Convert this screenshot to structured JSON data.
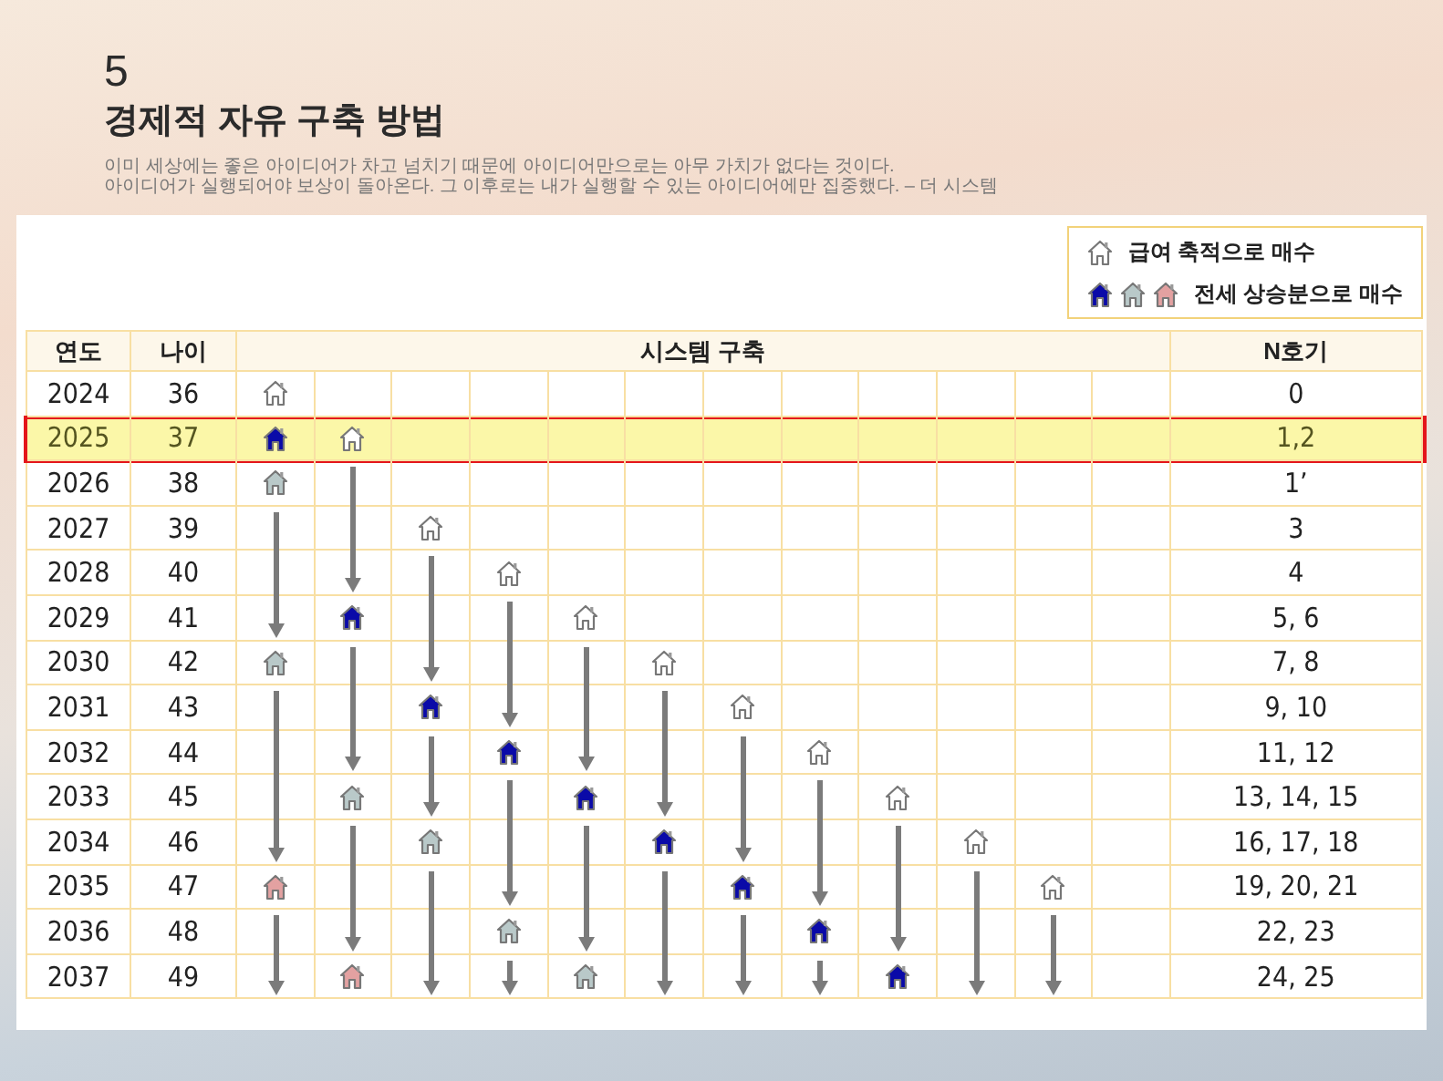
{
  "section_number": "5",
  "title": "경제적 자유 구축 방법",
  "quote_lines": [
    "이미 세상에는 좋은 아이디어가 차고 넘치기 때문에 아이디어만으로는 아무 가치가 없다는 것이다.",
    "아이디어가 실행되어야 보상이 돌아온다. 그 이후로는 내가 실행할 수 있는 아이디어에만 집중했다. – 더 시스템"
  ],
  "legend": [
    {
      "icons": [
        {
          "kind": "outline"
        }
      ],
      "label": "급여 축적으로 매수"
    },
    {
      "icons": [
        {
          "kind": "blue"
        },
        {
          "kind": "grey"
        },
        {
          "kind": "pink"
        }
      ],
      "label": "전세 상승분으로 매수"
    }
  ],
  "table": {
    "columns": [
      "연도",
      "나이",
      "시스템 구축",
      "N호기"
    ],
    "rows": [
      {
        "year": "2024",
        "age": "36",
        "units": "0",
        "selected": false,
        "cells": [
          {
            "kind": "outline"
          },
          {
            "kind": "empty"
          },
          {
            "kind": "empty"
          },
          {
            "kind": "empty"
          },
          {
            "kind": "empty"
          },
          {
            "kind": "empty"
          },
          {
            "kind": "empty"
          },
          {
            "kind": "empty"
          },
          {
            "kind": "empty"
          },
          {
            "kind": "empty"
          },
          {
            "kind": "empty"
          },
          {
            "kind": "empty"
          }
        ]
      },
      {
        "year": "2025",
        "age": "37",
        "units": "1,2",
        "selected": true,
        "cells": [
          {
            "kind": "blue"
          },
          {
            "kind": "outline"
          },
          {
            "kind": "empty"
          },
          {
            "kind": "empty"
          },
          {
            "kind": "empty"
          },
          {
            "kind": "empty"
          },
          {
            "kind": "empty"
          },
          {
            "kind": "empty"
          },
          {
            "kind": "empty"
          },
          {
            "kind": "empty"
          },
          {
            "kind": "empty"
          },
          {
            "kind": "empty"
          }
        ]
      },
      {
        "year": "2026",
        "age": "38",
        "units": "1’",
        "selected": false,
        "cells": [
          {
            "kind": "grey"
          },
          {
            "kind": "empty"
          },
          {
            "kind": "empty"
          },
          {
            "kind": "empty"
          },
          {
            "kind": "empty"
          },
          {
            "kind": "empty"
          },
          {
            "kind": "empty"
          },
          {
            "kind": "empty"
          },
          {
            "kind": "empty"
          },
          {
            "kind": "empty"
          },
          {
            "kind": "empty"
          },
          {
            "kind": "empty"
          }
        ]
      },
      {
        "year": "2027",
        "age": "39",
        "units": "3",
        "selected": false,
        "cells": [
          {
            "kind": "empty"
          },
          {
            "kind": "empty"
          },
          {
            "kind": "outline"
          },
          {
            "kind": "empty"
          },
          {
            "kind": "empty"
          },
          {
            "kind": "empty"
          },
          {
            "kind": "empty"
          },
          {
            "kind": "empty"
          },
          {
            "kind": "empty"
          },
          {
            "kind": "empty"
          },
          {
            "kind": "empty"
          },
          {
            "kind": "empty"
          }
        ]
      },
      {
        "year": "2028",
        "age": "40",
        "units": "4",
        "selected": false,
        "cells": [
          {
            "kind": "empty"
          },
          {
            "kind": "empty"
          },
          {
            "kind": "empty"
          },
          {
            "kind": "outline"
          },
          {
            "kind": "empty"
          },
          {
            "kind": "empty"
          },
          {
            "kind": "empty"
          },
          {
            "kind": "empty"
          },
          {
            "kind": "empty"
          },
          {
            "kind": "empty"
          },
          {
            "kind": "empty"
          },
          {
            "kind": "empty"
          }
        ]
      },
      {
        "year": "2029",
        "age": "41",
        "units": "5, 6",
        "selected": false,
        "cells": [
          {
            "kind": "empty"
          },
          {
            "kind": "blue"
          },
          {
            "kind": "empty"
          },
          {
            "kind": "empty"
          },
          {
            "kind": "outline"
          },
          {
            "kind": "empty"
          },
          {
            "kind": "empty"
          },
          {
            "kind": "empty"
          },
          {
            "kind": "empty"
          },
          {
            "kind": "empty"
          },
          {
            "kind": "empty"
          },
          {
            "kind": "empty"
          }
        ]
      },
      {
        "year": "2030",
        "age": "42",
        "units": "7, 8",
        "selected": false,
        "cells": [
          {
            "kind": "grey"
          },
          {
            "kind": "empty"
          },
          {
            "kind": "empty"
          },
          {
            "kind": "empty"
          },
          {
            "kind": "empty"
          },
          {
            "kind": "outline"
          },
          {
            "kind": "empty"
          },
          {
            "kind": "empty"
          },
          {
            "kind": "empty"
          },
          {
            "kind": "empty"
          },
          {
            "kind": "empty"
          },
          {
            "kind": "empty"
          }
        ]
      },
      {
        "year": "2031",
        "age": "43",
        "units": "9, 10",
        "selected": false,
        "cells": [
          {
            "kind": "empty"
          },
          {
            "kind": "empty"
          },
          {
            "kind": "blue"
          },
          {
            "kind": "empty"
          },
          {
            "kind": "empty"
          },
          {
            "kind": "empty"
          },
          {
            "kind": "outline"
          },
          {
            "kind": "empty"
          },
          {
            "kind": "empty"
          },
          {
            "kind": "empty"
          },
          {
            "kind": "empty"
          },
          {
            "kind": "empty"
          }
        ]
      },
      {
        "year": "2032",
        "age": "44",
        "units": "11, 12",
        "selected": false,
        "cells": [
          {
            "kind": "empty"
          },
          {
            "kind": "empty"
          },
          {
            "kind": "empty"
          },
          {
            "kind": "blue"
          },
          {
            "kind": "empty"
          },
          {
            "kind": "empty"
          },
          {
            "kind": "empty"
          },
          {
            "kind": "outline"
          },
          {
            "kind": "empty"
          },
          {
            "kind": "empty"
          },
          {
            "kind": "empty"
          },
          {
            "kind": "empty"
          }
        ]
      },
      {
        "year": "2033",
        "age": "45",
        "units": "13, 14, 15",
        "selected": false,
        "cells": [
          {
            "kind": "empty"
          },
          {
            "kind": "grey"
          },
          {
            "kind": "empty"
          },
          {
            "kind": "empty"
          },
          {
            "kind": "blue"
          },
          {
            "kind": "empty"
          },
          {
            "kind": "empty"
          },
          {
            "kind": "empty"
          },
          {
            "kind": "outline"
          },
          {
            "kind": "empty"
          },
          {
            "kind": "empty"
          },
          {
            "kind": "empty"
          }
        ]
      },
      {
        "year": "2034",
        "age": "46",
        "units": "16, 17, 18",
        "selected": false,
        "cells": [
          {
            "kind": "empty"
          },
          {
            "kind": "empty"
          },
          {
            "kind": "grey"
          },
          {
            "kind": "empty"
          },
          {
            "kind": "empty"
          },
          {
            "kind": "blue"
          },
          {
            "kind": "empty"
          },
          {
            "kind": "empty"
          },
          {
            "kind": "empty"
          },
          {
            "kind": "outline"
          },
          {
            "kind": "empty"
          },
          {
            "kind": "empty"
          }
        ]
      },
      {
        "year": "2035",
        "age": "47",
        "units": "19, 20, 21",
        "selected": false,
        "cells": [
          {
            "kind": "pink"
          },
          {
            "kind": "empty"
          },
          {
            "kind": "empty"
          },
          {
            "kind": "empty"
          },
          {
            "kind": "empty"
          },
          {
            "kind": "empty"
          },
          {
            "kind": "blue"
          },
          {
            "kind": "empty"
          },
          {
            "kind": "empty"
          },
          {
            "kind": "empty"
          },
          {
            "kind": "outline"
          },
          {
            "kind": "empty"
          }
        ]
      },
      {
        "year": "2036",
        "age": "48",
        "units": "22, 23",
        "selected": false,
        "cells": [
          {
            "kind": "empty"
          },
          {
            "kind": "empty"
          },
          {
            "kind": "empty"
          },
          {
            "kind": "grey"
          },
          {
            "kind": "empty"
          },
          {
            "kind": "empty"
          },
          {
            "kind": "empty"
          },
          {
            "kind": "blue"
          },
          {
            "kind": "empty"
          },
          {
            "kind": "empty"
          },
          {
            "kind": "empty"
          },
          {
            "kind": "empty"
          }
        ]
      },
      {
        "year": "2037",
        "age": "49",
        "units": "24, 25",
        "selected": false,
        "cells": [
          {
            "kind": "empty"
          },
          {
            "kind": "pink"
          },
          {
            "kind": "empty"
          },
          {
            "kind": "empty"
          },
          {
            "kind": "grey"
          },
          {
            "kind": "empty"
          },
          {
            "kind": "empty"
          },
          {
            "kind": "empty"
          },
          {
            "kind": "blue"
          },
          {
            "kind": "empty"
          },
          {
            "kind": "empty"
          },
          {
            "kind": "empty"
          }
        ]
      }
    ]
  }
}
